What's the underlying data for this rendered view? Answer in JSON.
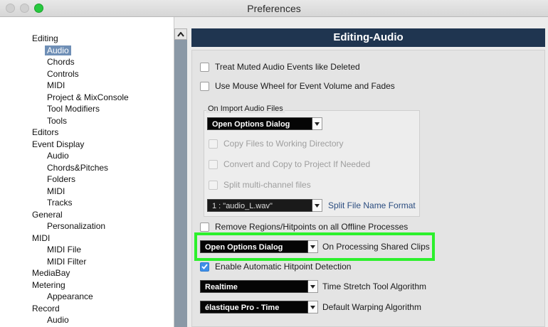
{
  "window": {
    "title": "Preferences"
  },
  "sidebar": {
    "items": [
      {
        "label": "Editing",
        "level": 0
      },
      {
        "label": "Audio",
        "level": 1,
        "selected": true
      },
      {
        "label": "Chords",
        "level": 1
      },
      {
        "label": "Controls",
        "level": 1
      },
      {
        "label": "MIDI",
        "level": 1
      },
      {
        "label": "Project & MixConsole",
        "level": 1
      },
      {
        "label": "Tool Modifiers",
        "level": 1
      },
      {
        "label": "Tools",
        "level": 1
      },
      {
        "label": "Editors",
        "level": 0
      },
      {
        "label": "Event Display",
        "level": 0
      },
      {
        "label": "Audio",
        "level": 1
      },
      {
        "label": "Chords&Pitches",
        "level": 1
      },
      {
        "label": "Folders",
        "level": 1
      },
      {
        "label": "MIDI",
        "level": 1
      },
      {
        "label": "Tracks",
        "level": 1
      },
      {
        "label": "General",
        "level": 0
      },
      {
        "label": "Personalization",
        "level": 1
      },
      {
        "label": "MIDI",
        "level": 0
      },
      {
        "label": "MIDI File",
        "level": 1
      },
      {
        "label": "MIDI Filter",
        "level": 1
      },
      {
        "label": "MediaBay",
        "level": 0
      },
      {
        "label": "Metering",
        "level": 0
      },
      {
        "label": "Appearance",
        "level": 1
      },
      {
        "label": "Record",
        "level": 0
      },
      {
        "label": "Audio",
        "level": 1
      }
    ]
  },
  "main": {
    "header": "Editing-Audio",
    "treat_muted": {
      "label": "Treat Muted Audio Events like Deleted",
      "checked": false
    },
    "mouse_wheel": {
      "label": "Use Mouse Wheel for Event Volume and Fades",
      "checked": false
    },
    "import_group": {
      "title": "On Import Audio Files",
      "dialog_select": "Open Options Dialog",
      "copy_files": {
        "label": "Copy Files to Working Directory",
        "checked": false,
        "disabled": true
      },
      "convert_copy": {
        "label": "Convert and Copy to Project If Needed",
        "checked": false,
        "disabled": true
      },
      "split_channels": {
        "label": "Split multi-channel files",
        "checked": false,
        "disabled": true
      },
      "split_format_select": "1 : \"audio_L.wav\"",
      "split_format_link": "Split File Name Format"
    },
    "remove_regions": {
      "label": "Remove Regions/Hitpoints on all Offline Processes",
      "checked": false
    },
    "shared_clips": {
      "select": "Open Options Dialog",
      "label": "On Processing Shared Clips"
    },
    "hitpoint_detection": {
      "label": "Enable Automatic Hitpoint Detection",
      "checked": true
    },
    "time_stretch": {
      "select": "Realtime",
      "label": "Time Stretch Tool Algorithm"
    },
    "warping": {
      "select": "élastique Pro - Time",
      "label": "Default Warping Algorithm"
    }
  },
  "colors": {
    "header_bg": "#1f3550",
    "selection": "#6f8fb6",
    "highlight": "#2cf02c",
    "checkbox_checked": "#3f8fe8"
  }
}
